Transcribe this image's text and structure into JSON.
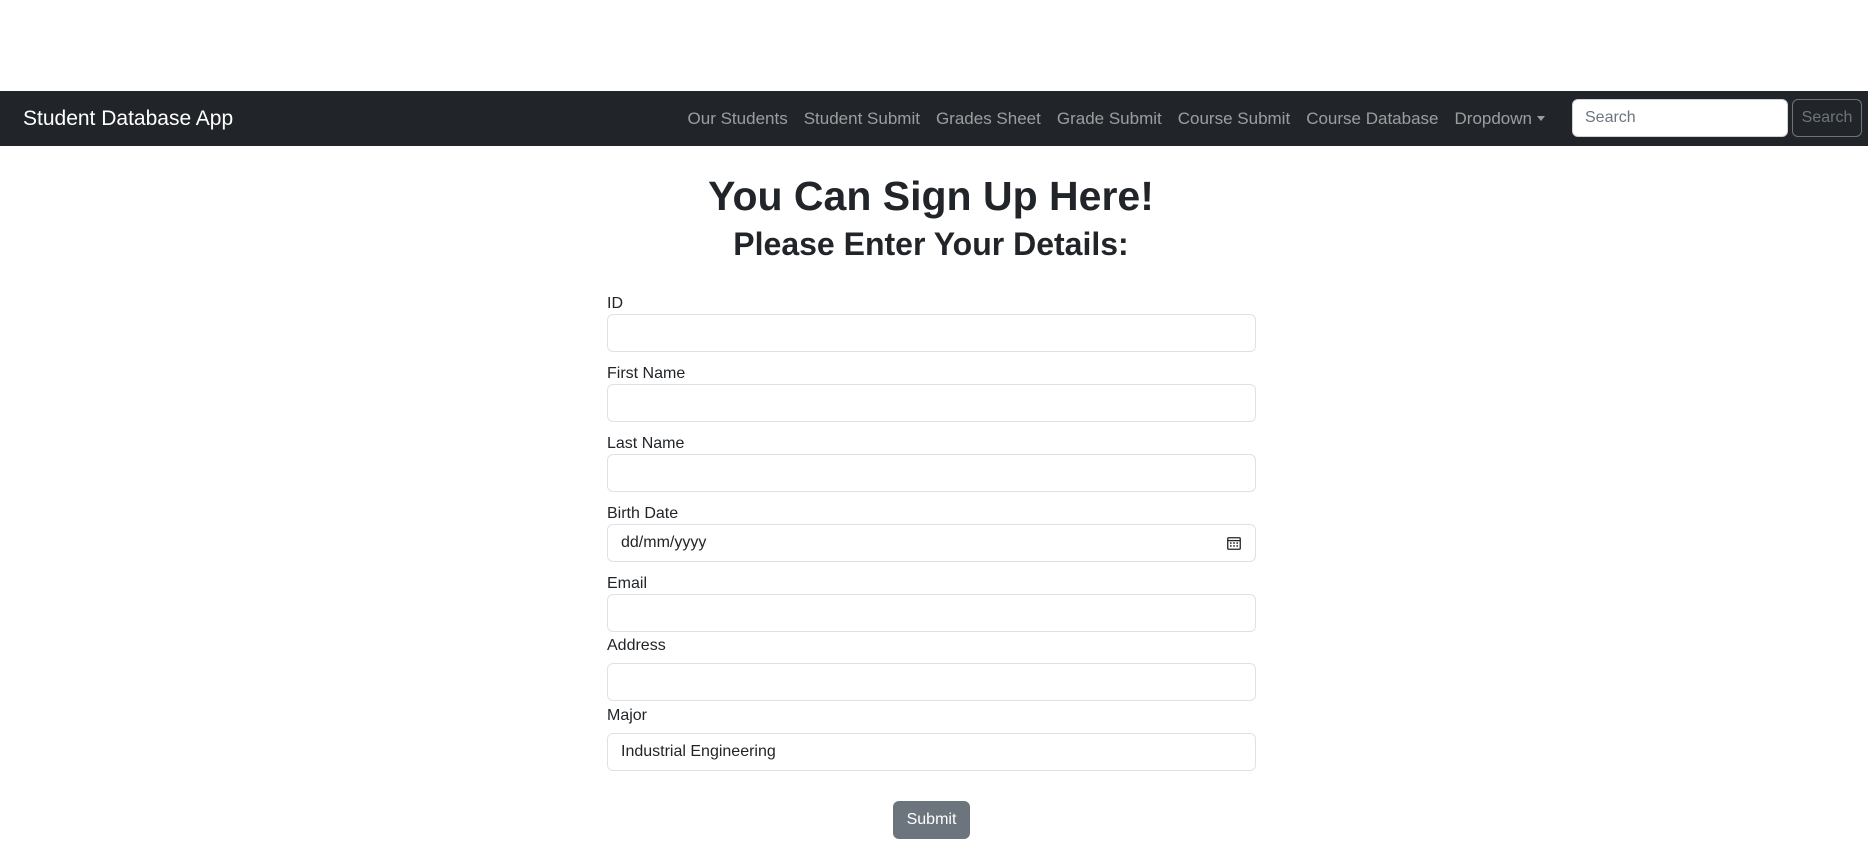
{
  "navbar": {
    "brand": "Student Database App",
    "links": [
      "Our Students",
      "Student Submit",
      "Grades Sheet",
      "Grade Submit",
      "Course Submit",
      "Course Database",
      "Dropdown"
    ],
    "search_placeholder": "Search",
    "search_button": "Search"
  },
  "page": {
    "title": "You Can Sign Up Here!",
    "subtitle": "Please Enter Your Details:"
  },
  "form": {
    "fields": {
      "id": {
        "label": "ID",
        "value": ""
      },
      "first_name": {
        "label": "First Name",
        "value": ""
      },
      "last_name": {
        "label": "Last Name",
        "value": ""
      },
      "birth_date": {
        "label": "Birth Date",
        "placeholder": "dd/mm/yyyy"
      },
      "email": {
        "label": "Email",
        "value": ""
      },
      "address": {
        "label": "Address",
        "value": ""
      },
      "major": {
        "label": "Major",
        "value": "Industrial Engineering"
      }
    },
    "submit_label": "Submit"
  },
  "colors": {
    "navbar_bg": "#212529",
    "button_secondary": "#6c757d"
  },
  "icons": {
    "birth_date": "calendar-icon",
    "dropdown": "caret-down-icon"
  }
}
